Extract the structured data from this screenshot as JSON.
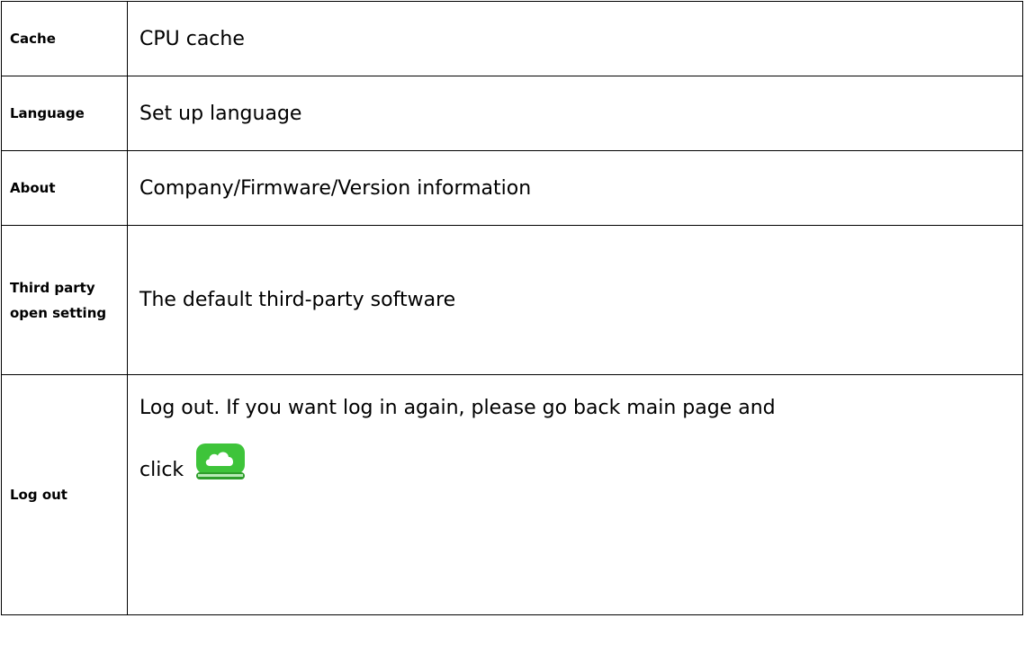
{
  "rows": [
    {
      "label": "Cache",
      "description": "CPU cache"
    },
    {
      "label": "Language",
      "description": "Set up language"
    },
    {
      "label": "About",
      "description": "Company/Firmware/Version information"
    },
    {
      "label": "Third party open setting",
      "description": "The default third-party software"
    },
    {
      "label": "Log out",
      "description_line1": "Log out. If you want log in again, please go back main page and",
      "description_line2": "click",
      "icon": "cloud-drive-icon"
    }
  ],
  "colors": {
    "border": "#000000",
    "icon_green": "#3ec43a",
    "icon_green_dark": "#2f9e2c"
  }
}
